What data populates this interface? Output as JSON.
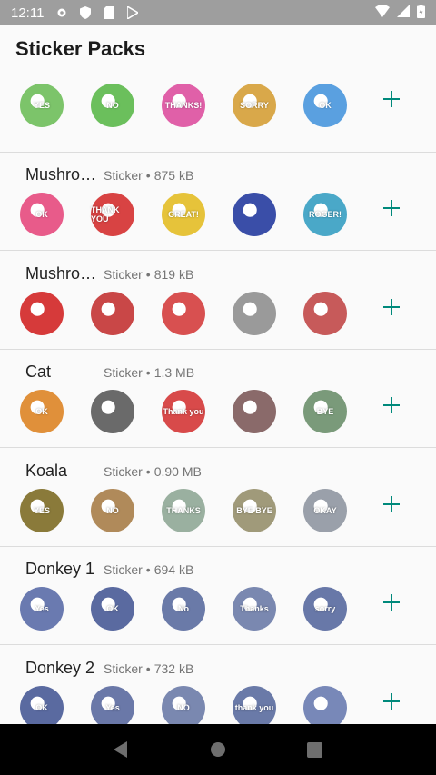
{
  "status": {
    "time": "12:11"
  },
  "header": {
    "title": "Sticker Packs"
  },
  "packs": [
    {
      "name": "",
      "sep": "",
      "size": "",
      "meta_prefix": "",
      "stickers": [
        {
          "label": "YES",
          "color": "#7cc46a"
        },
        {
          "label": "NO",
          "color": "#6bbf5c"
        },
        {
          "label": "THANKS!",
          "color": "#e060a8"
        },
        {
          "label": "SORRY",
          "color": "#d9a84a"
        },
        {
          "label": "OK",
          "color": "#5aa0e0"
        }
      ]
    },
    {
      "name": "Mushro…",
      "meta_prefix": "Sticker",
      "sep": "•",
      "size": "875 kB",
      "stickers": [
        {
          "label": "OK",
          "color": "#e85b8a"
        },
        {
          "label": "THANK YOU",
          "color": "#d84343"
        },
        {
          "label": "GREAT!",
          "color": "#e6c33a"
        },
        {
          "label": "",
          "color": "#3a4ea8"
        },
        {
          "label": "ROGER!",
          "color": "#4aa8c8"
        }
      ]
    },
    {
      "name": "Mushro…",
      "meta_prefix": "Sticker",
      "sep": "•",
      "size": "819 kB",
      "stickers": [
        {
          "label": "",
          "color": "#d63a3a"
        },
        {
          "label": "",
          "color": "#c94747"
        },
        {
          "label": "",
          "color": "#d85050"
        },
        {
          "label": "",
          "color": "#9a9a9a"
        },
        {
          "label": "",
          "color": "#c75a5a"
        }
      ]
    },
    {
      "name": "Cat",
      "meta_prefix": "Sticker",
      "sep": "•",
      "size": "1.3 MB",
      "stickers": [
        {
          "label": "OK",
          "color": "#e0903a"
        },
        {
          "label": "",
          "color": "#6a6a6a"
        },
        {
          "label": "Thank you",
          "color": "#d84a4a"
        },
        {
          "label": "",
          "color": "#8a6a6a"
        },
        {
          "label": "BYE",
          "color": "#7a9a7a"
        }
      ]
    },
    {
      "name": "Koala",
      "meta_prefix": "Sticker",
      "sep": "•",
      "size": "0.90 MB",
      "stickers": [
        {
          "label": "YES",
          "color": "#8a7a3a"
        },
        {
          "label": "NO",
          "color": "#b08a5a"
        },
        {
          "label": "THANKS",
          "color": "#9ab0a0"
        },
        {
          "label": "BYE BYE",
          "color": "#a09a7a"
        },
        {
          "label": "OKAY",
          "color": "#9aa0aa"
        }
      ]
    },
    {
      "name": "Donkey 1",
      "meta_prefix": "Sticker",
      "sep": "•",
      "size": "694 kB",
      "stickers": [
        {
          "label": "Yes",
          "color": "#6a7ab0"
        },
        {
          "label": "OK",
          "color": "#5a6aa0"
        },
        {
          "label": "No",
          "color": "#6a7aa8"
        },
        {
          "label": "Thanks",
          "color": "#7a88b0"
        },
        {
          "label": "sorry",
          "color": "#6878a8"
        }
      ]
    },
    {
      "name": "Donkey 2",
      "meta_prefix": "Sticker",
      "sep": "•",
      "size": "732 kB",
      "stickers": [
        {
          "label": "OK",
          "color": "#5a6aa0"
        },
        {
          "label": "Yes",
          "color": "#6a78a8"
        },
        {
          "label": "NO",
          "color": "#7a88b0"
        },
        {
          "label": "thank you",
          "color": "#6a7aa8"
        },
        {
          "label": "",
          "color": "#7888b8"
        }
      ]
    }
  ],
  "colors": {
    "accent": "#00897b",
    "statusbar": "#9e9e9e",
    "navbar": "#000000"
  }
}
